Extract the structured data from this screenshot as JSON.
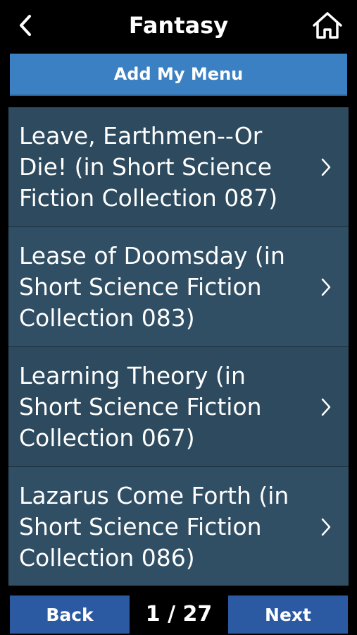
{
  "header": {
    "title": "Fantasy",
    "back_icon": "chevron-left-icon",
    "home_icon": "home-icon"
  },
  "add_menu_label": "Add My Menu",
  "list": {
    "items": [
      {
        "label": "Leave, Earthmen--Or Die! (in Short Science Fiction Collection 087)"
      },
      {
        "label": "Lease of Doomsday (in Short Science Fiction Collection 083)"
      },
      {
        "label": "Learning Theory (in Short Science Fiction Collection 067)"
      },
      {
        "label": "Lazarus Come Forth (in Short Science Fiction Collection 086)"
      }
    ]
  },
  "footer": {
    "back_label": "Back",
    "pager": "1 / 27",
    "next_label": "Next"
  },
  "colors": {
    "background": "#000000",
    "accent_button": "#3a80c2",
    "list_bg": "#2d4a5e",
    "nav_button": "#2b5aa3"
  }
}
